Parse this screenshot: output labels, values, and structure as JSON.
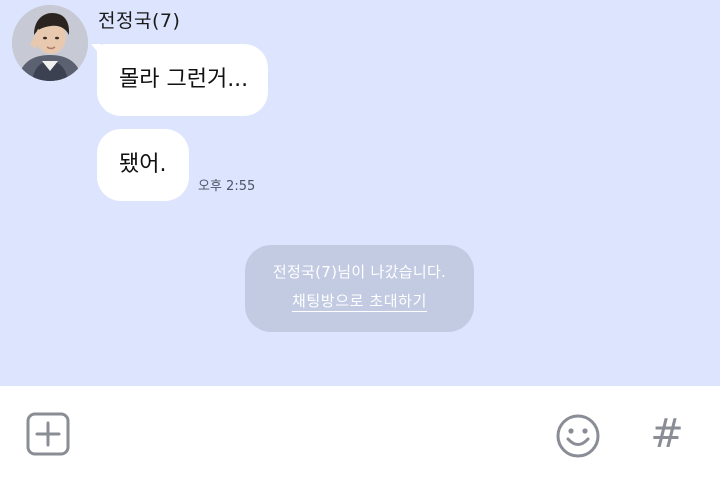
{
  "chat": {
    "sender_name": "전정국(7)",
    "messages": [
      {
        "text": "몰라 그런거..."
      },
      {
        "text": "됐어."
      }
    ],
    "last_time": "오후 2:55"
  },
  "system_notice": {
    "text": "전정국(7)님이 나갔습니다.",
    "invite_label": "채팅방으로 초대하기"
  },
  "input_bar": {
    "add_icon": "plus-square-icon",
    "emoji_icon": "smiley-icon",
    "hash_icon": "hash-icon",
    "hash_symbol": "#"
  },
  "colors": {
    "chat_background": "#dde4fe",
    "bubble": "#ffffff",
    "notice_background": "#c3cbe3",
    "icon_gray": "#8a8d96"
  }
}
